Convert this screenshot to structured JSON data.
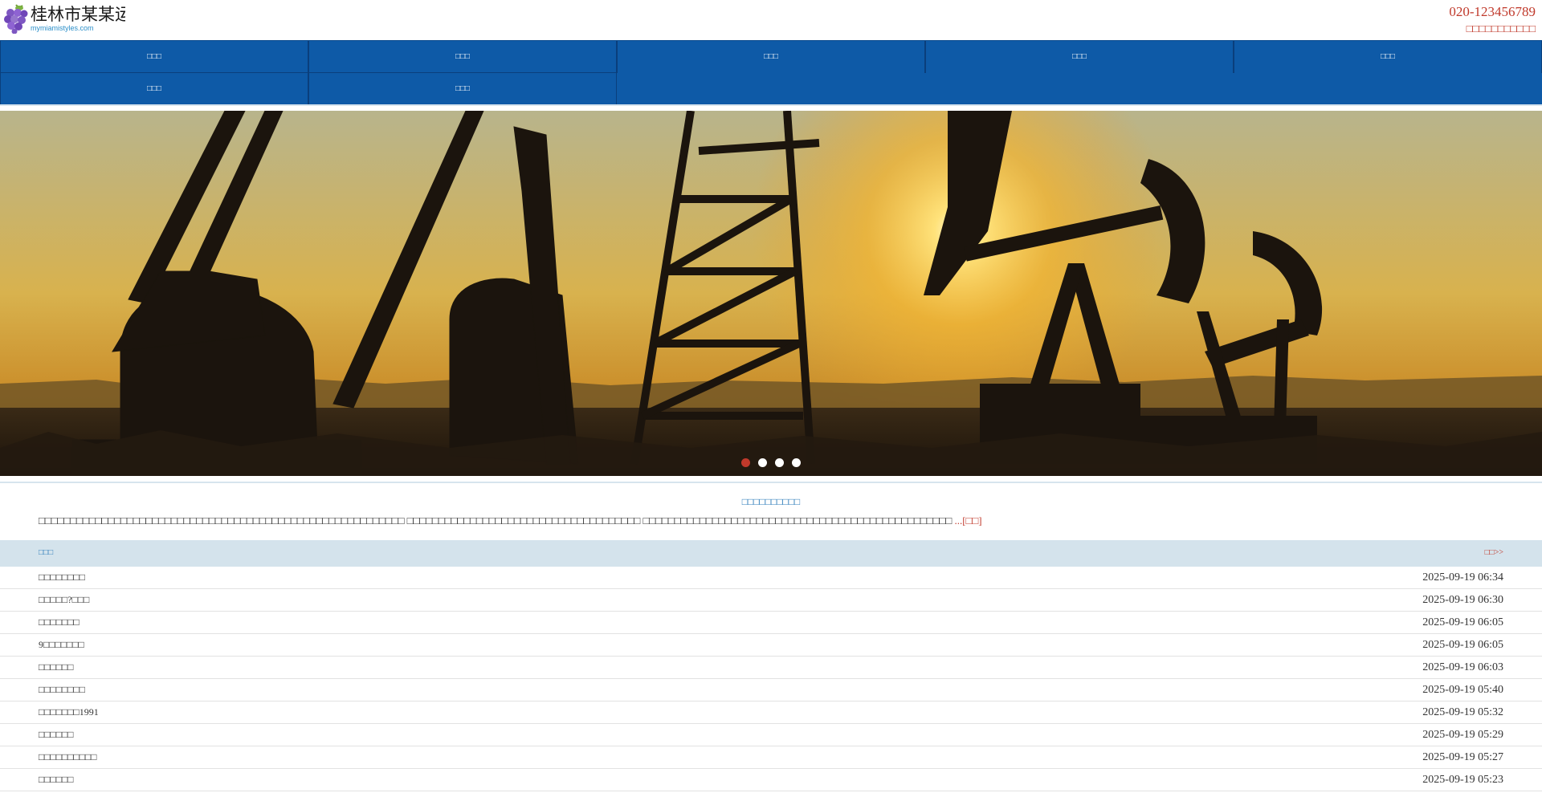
{
  "header": {
    "site_name": "桂林市某某运",
    "domain": "mymiamistyles.com",
    "phone": "020-123456789",
    "slogan": "□□□□□□□□□□□"
  },
  "nav": {
    "items": [
      {
        "label": "□□□"
      },
      {
        "label": "□□□"
      },
      {
        "label": "□□□"
      },
      {
        "label": "□□□"
      },
      {
        "label": "□□□"
      },
      {
        "label": "□□□"
      },
      {
        "label": "□□□"
      }
    ]
  },
  "banner": {
    "slides": 4,
    "active_slide": 1,
    "image_icon": "oil-pumpjack-sunset-photo"
  },
  "intro": {
    "title": "□□□□□□□□□□",
    "text": "□□□□□□□□□□□□□□□□□□□□□□□□□□□□□□□□□□□□□□□□□□□□□□□□□□□□□□□□□□ □□□□□□□□□□□□□□□□□□□□□□□□□□□□□□□□□□□□□ □□□□□□□□□□□□□□□□□□□□□□□□□□□□□□□□□□□□□□□□□□□□□□□□□ ",
    "ellipsis": "...",
    "more_label": "[□□]"
  },
  "news": {
    "section_title": "□□□",
    "more_label": "□□>>",
    "items": [
      {
        "title": "□□□□□□□□",
        "date": "2025-09-19 06:34"
      },
      {
        "title": "□□□□□?□□□",
        "date": "2025-09-19 06:30"
      },
      {
        "title": "□□□□□□□",
        "date": "2025-09-19 06:05"
      },
      {
        "title": "9□□□□□□□",
        "date": "2025-09-19 06:05"
      },
      {
        "title": "□□□□□□",
        "date": "2025-09-19 06:03"
      },
      {
        "title": "□□□□□□□□",
        "date": "2025-09-19 05:40"
      },
      {
        "title": "□□□□□□□1991",
        "date": "2025-09-19 05:32"
      },
      {
        "title": "□□□□□□",
        "date": "2025-09-19 05:29"
      },
      {
        "title": "□□□□□□□□□□",
        "date": "2025-09-19 05:27"
      },
      {
        "title": "□□□□□□",
        "date": "2025-09-19 05:23"
      }
    ]
  },
  "colors": {
    "nav_bg": "#0e5aa7",
    "accent_red": "#c0392b",
    "accent_blue": "#2b7bb9",
    "news_header_bg": "#d4e3ec"
  }
}
